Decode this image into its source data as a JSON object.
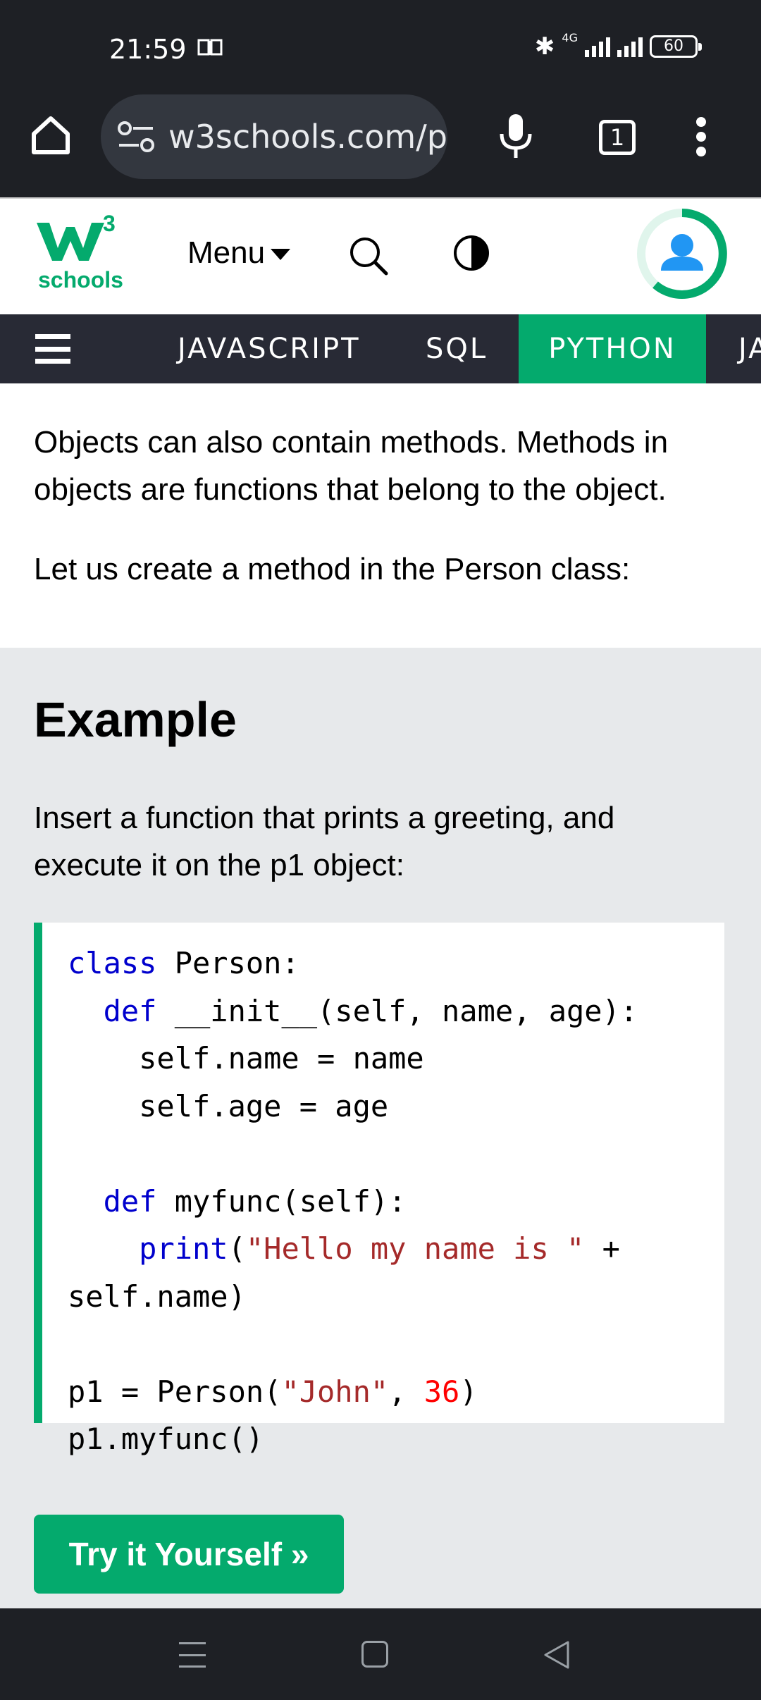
{
  "status_bar": {
    "time": "21:59",
    "network": "4G",
    "battery": "60"
  },
  "browser": {
    "url": "w3schools.com/p",
    "tab_count": "1"
  },
  "header": {
    "logo_text": "schools",
    "logo_superscript": "3",
    "menu_label": "Menu"
  },
  "nav": {
    "items": [
      "JAVASCRIPT",
      "SQL",
      "PYTHON",
      "JA"
    ],
    "active": "PYTHON"
  },
  "content": {
    "para1": "Objects can also contain methods. Methods in objects are functions that belong to the object.",
    "para2": "Let us create a method in the Person class:"
  },
  "example": {
    "title": "Example",
    "description": "Insert a function that prints a greeting, and execute it on the p1 object:",
    "code": {
      "l1_kw": "class",
      "l1_rest": " Person:",
      "l2_indent": "  ",
      "l2_kw": "def",
      "l2_rest": " __init__(self, name, age):",
      "l3": "    self.name = name",
      "l4": "    self.age = age",
      "l6_indent": "  ",
      "l6_kw": "def",
      "l6_rest": " myfunc(self):",
      "l7_indent": "    ",
      "l7_kw": "print",
      "l7_paren": "(",
      "l7_str": "\"Hello my name is \"",
      "l7_rest": " +",
      "l8": "self.name)",
      "l10_pre": "p1 = Person(",
      "l10_str": "\"John\"",
      "l10_mid": ", ",
      "l10_num": "36",
      "l10_end": ")",
      "l11": "p1.myfunc()"
    },
    "try_button": "Try it Yourself »"
  },
  "colors": {
    "brand_green": "#04aa6d",
    "nav_dark": "#282a35",
    "example_bg": "#e7e9eb"
  }
}
